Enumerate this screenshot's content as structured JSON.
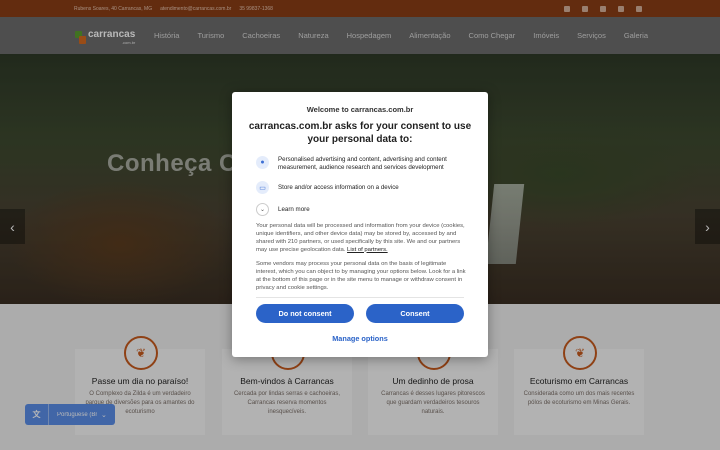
{
  "topbar": {
    "address": "Rubens Soares, 40 Carrancas, MG",
    "email": "atendimento@carrancas.com.br",
    "phone": "35 99837-1368",
    "social_icons": [
      "facebook-icon",
      "twitter-icon",
      "youtube-icon",
      "instagram-icon",
      "tripadvisor-icon"
    ]
  },
  "logo": {
    "name": "carrancas",
    "suffix": ".com.br"
  },
  "menu": [
    "História",
    "Turismo",
    "Cachoeiras",
    "Natureza",
    "Hospedagem",
    "Alimentação",
    "Como Chegar",
    "Imóveis",
    "Serviços",
    "Galeria"
  ],
  "hero": {
    "title": "Conheça Ca"
  },
  "features": [
    {
      "title": "Passe um dia no paraíso!",
      "text": "O Complexo da Zilda é um verdadeiro parque de diversões para os amantes do ecoturismo"
    },
    {
      "title": "Bem-vindos à Carrancas",
      "text": "Cercada por lindas serras e cachoeiras, Carrancas reserva momentos inesquecíveis."
    },
    {
      "title": "Um dedinho de prosa",
      "text": "Carrancas é desses lugares pitorescos que guardam verdadeiros tesouros naturais."
    },
    {
      "title": "Ecoturismo em Carrancas",
      "text": "Considerada como um dos mais recentes pólos de ecoturismo em Minas Gerais."
    }
  ],
  "language": {
    "selected": "Portuguese (Brazil)"
  },
  "consent": {
    "welcome": "Welcome to carrancas.com.br",
    "title": "carrancas.com.br asks for your consent to use your personal data to:",
    "purposes": [
      {
        "icon": "user-icon",
        "text": "Personalised advertising and content, advertising and content measurement, audience research and services development"
      },
      {
        "icon": "device-icon",
        "text": "Store and/or access information on a device"
      }
    ],
    "learn_more": "Learn more",
    "paragraph1": "Your personal data will be processed and information from your device (cookies, unique identifiers, and other device data) may be stored by, accessed by and shared with 210 partners, or used specifically by this site. We and our partners may use precise geolocation data.",
    "partners_link": "List of partners.",
    "paragraph2": "Some vendors may process your personal data on the basis of legitimate interest, which you can object to by managing your options below. Look for a link at the bottom of this page or in the site menu to manage or withdraw consent in privacy and cookie settings.",
    "do_not_consent": "Do not consent",
    "consent": "Consent",
    "manage_options": "Manage options"
  },
  "colors": {
    "accent": "#c75a1e",
    "button": "#2b63c8",
    "topbar": "#8a3d16"
  }
}
